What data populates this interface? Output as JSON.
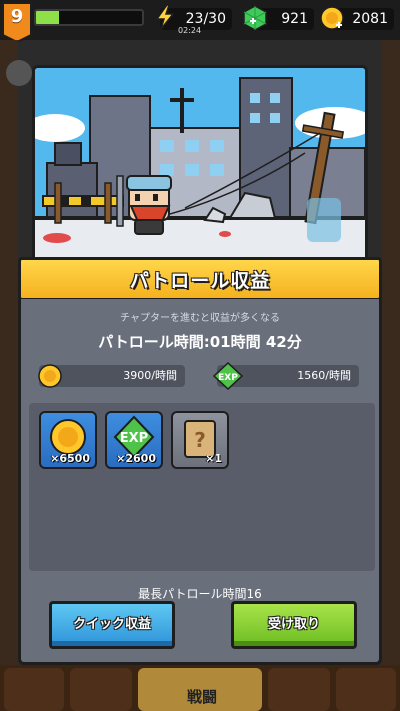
{
  "player": {
    "level": "9",
    "xp_fraction": 0.22
  },
  "resources": {
    "energy": {
      "value": "23/30",
      "timer": "02:24",
      "icon": "lightning-icon"
    },
    "gems": {
      "value": "921",
      "icon": "green-gem-icon"
    },
    "coins": {
      "value": "2081",
      "icon": "coin-icon"
    }
  },
  "dialog": {
    "title": "パトロール収益",
    "subtitle": "チャプターを進むと収益が多くなる",
    "patrol_time": "パトロール時間:01時間 42分",
    "rates": {
      "gold": {
        "value": "3900/時間",
        "icon": "coin-icon"
      },
      "exp": {
        "value": "1560/時間",
        "icon": "exp-icon",
        "icon_label": "EXP"
      }
    },
    "rewards": [
      {
        "name": "gold",
        "qty": "×6500",
        "icon": "coin-icon"
      },
      {
        "name": "exp",
        "qty": "×2600",
        "icon": "exp-icon",
        "icon_label": "EXP"
      },
      {
        "name": "mystery-scroll",
        "qty": "×1",
        "icon": "question-scroll-icon"
      }
    ],
    "max_patrol": "最長パトロール時間16",
    "buttons": {
      "quick": "クイック収益",
      "receive": "受け取り"
    }
  },
  "bottom_nav": {
    "battle_label": "戦闘"
  },
  "colors": {
    "title_bar": "#f5b21f",
    "quick_button": "#2f93d9",
    "receive_button": "#6cbd22",
    "panel": "#6a6f7c",
    "xp_bar": "#8de04a"
  }
}
